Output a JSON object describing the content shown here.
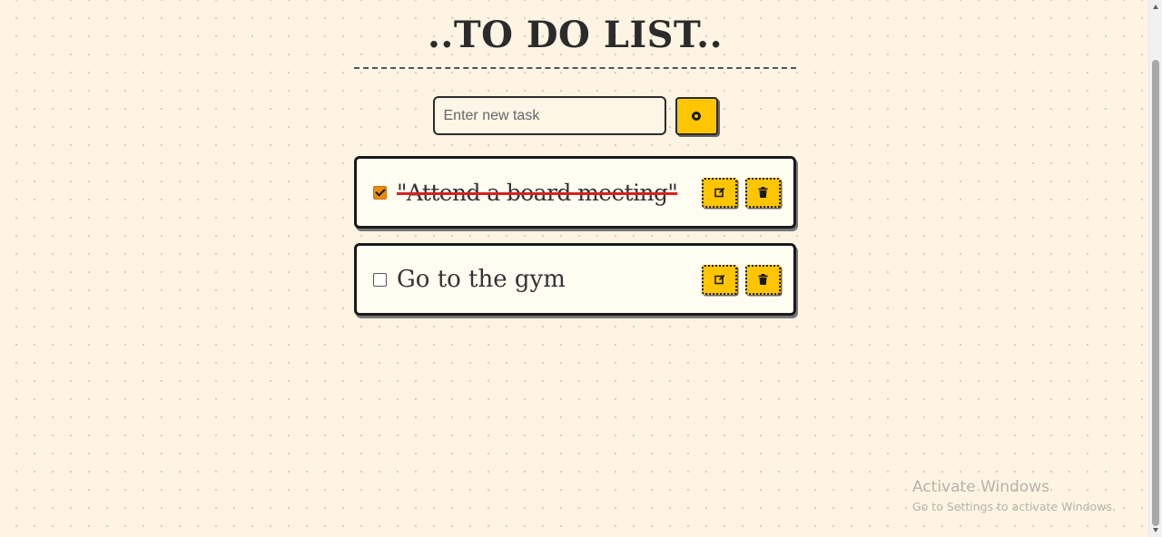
{
  "header": {
    "title": "..TO DO LIST.."
  },
  "add_task": {
    "placeholder": "Enter new task",
    "value": "",
    "button_icon": "plus-circle-icon"
  },
  "tasks": [
    {
      "text": "\"Attend a board meeting\"",
      "completed": true,
      "edit_icon": "edit-icon",
      "delete_icon": "trash-icon"
    },
    {
      "text": "Go to the gym",
      "completed": false,
      "edit_icon": "edit-icon",
      "delete_icon": "trash-icon"
    }
  ],
  "watermark": {
    "title": "Activate Windows",
    "subtitle": "Go to Settings to activate Windows."
  },
  "colors": {
    "background": "#fdf4e3",
    "accent_yellow": "#ffc600",
    "checkbox_checked": "#e98b10",
    "strike_red": "#d42020",
    "border_dark": "#1a1a1a"
  }
}
